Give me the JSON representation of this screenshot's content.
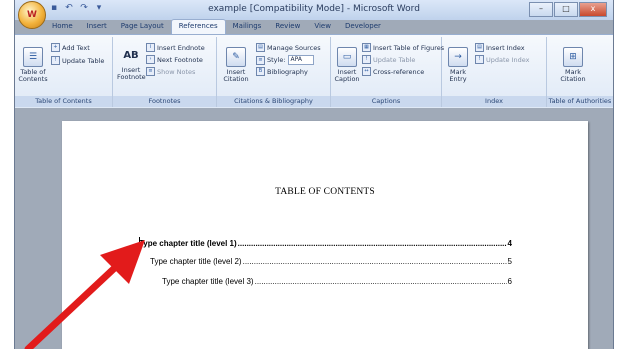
{
  "window": {
    "title": "example [Compatibility Mode] - Microsoft Word",
    "controls": {
      "minimize": "–",
      "maximize": "□",
      "close": "x"
    }
  },
  "office_button_label": "W",
  "quick_access_icons": [
    "save-icon",
    "undo-icon",
    "redo-icon",
    "customize-icon"
  ],
  "tabs": [
    {
      "label": "Home"
    },
    {
      "label": "Insert"
    },
    {
      "label": "Page Layout"
    },
    {
      "label": "References",
      "active": true
    },
    {
      "label": "Mailings"
    },
    {
      "label": "Review"
    },
    {
      "label": "View"
    },
    {
      "label": "Developer"
    }
  ],
  "ribbon": {
    "toc_group": {
      "label": "Table of Contents",
      "table_of_contents": "Table of Contents",
      "add_text": "Add Text",
      "update_table": "Update Table"
    },
    "footnotes_group": {
      "label": "Footnotes",
      "insert_footnote": "Insert Footnote",
      "insert_endnote": "Insert Endnote",
      "next_footnote": "Next Footnote",
      "show_notes": "Show Notes",
      "footnote_glyph": "AB"
    },
    "citations_group": {
      "label": "Citations & Bibliography",
      "insert_citation": "Insert Citation",
      "manage_sources": "Manage Sources",
      "style_label": "Style:",
      "style_value": "APA",
      "bibliography": "Bibliography"
    },
    "captions_group": {
      "label": "Captions",
      "insert_caption": "Insert Caption",
      "insert_table_of_figures": "Insert Table of Figures",
      "update_table": "Update Table",
      "cross_reference": "Cross-reference"
    },
    "index_group": {
      "label": "Index",
      "mark_entry": "Mark Entry",
      "insert_index": "Insert Index",
      "update_index": "Update Index"
    },
    "authorities_group": {
      "label": "Table of Authorities",
      "mark_citation": "Mark Citation"
    }
  },
  "document": {
    "heading": "TABLE OF CONTENTS",
    "entries": [
      {
        "text": "Type chapter title (level 1)",
        "page": "4"
      },
      {
        "text": "Type chapter title (level 2)",
        "page": "5"
      },
      {
        "text": "Type chapter title (level 3)",
        "page": "6"
      }
    ]
  },
  "colors": {
    "annotation_arrow": "#e21b1b",
    "ribbon_label_bar": "#c9d8ee",
    "document_background": "#a0aab8"
  }
}
